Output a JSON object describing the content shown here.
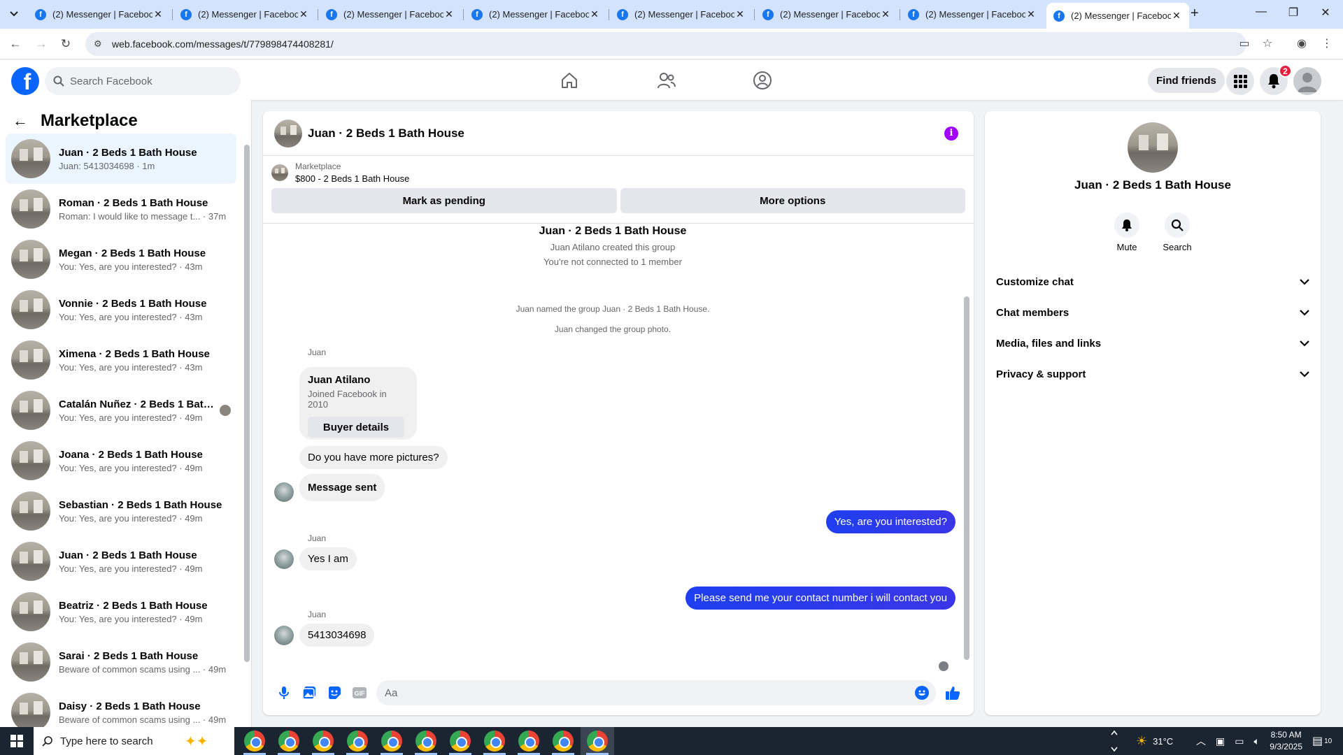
{
  "browser": {
    "tabs": [
      {
        "title": "(2) Messenger | Facebook"
      },
      {
        "title": "(2) Messenger | Facebook"
      },
      {
        "title": "(2) Messenger | Facebook"
      },
      {
        "title": "(2) Messenger | Facebook"
      },
      {
        "title": "(2) Messenger | Facebook"
      },
      {
        "title": "(2) Messenger | Facebook"
      },
      {
        "title": "(2) Messenger | Facebook"
      },
      {
        "title": "(2) Messenger | Facebook"
      }
    ],
    "url": "web.facebook.com/messages/t/779898474408281/"
  },
  "fb": {
    "search_placeholder": "Search Facebook",
    "find_friends": "Find friends",
    "notif_count": "2",
    "brand_color": "#0866ff"
  },
  "sidebar": {
    "title": "Marketplace",
    "conversations": [
      {
        "name": "Juan · 2 Beds 1 Bath House",
        "preview": "Juan: 5413034698 · 1m"
      },
      {
        "name": "Roman · 2 Beds 1 Bath House",
        "preview": "Roman: I would like to message t... · 37m"
      },
      {
        "name": "Megan · 2 Beds 1 Bath House",
        "preview": "You: Yes, are you interested? · 43m"
      },
      {
        "name": "Vonnie · 2 Beds 1 Bath House",
        "preview": "You: Yes, are you interested? · 43m"
      },
      {
        "name": "Ximena · 2 Beds 1 Bath House",
        "preview": "You: Yes, are you interested? · 43m"
      },
      {
        "name": "Catalán Nuñez · 2 Beds 1 Bath...",
        "preview": "You: Yes, are you interested? · 49m"
      },
      {
        "name": "Joana · 2 Beds 1 Bath House",
        "preview": "You: Yes, are you interested? · 49m"
      },
      {
        "name": "Sebastian · 2 Beds 1 Bath House",
        "preview": "You: Yes, are you interested? · 49m"
      },
      {
        "name": "Juan · 2 Beds 1 Bath House",
        "preview": "You: Yes, are you interested? · 49m"
      },
      {
        "name": "Beatriz · 2 Beds 1 Bath House",
        "preview": "You: Yes, are you interested? · 49m"
      },
      {
        "name": "Sarai · 2 Beds 1 Bath House",
        "preview": "Beware of common scams using ... · 49m"
      },
      {
        "name": "Daisy · 2 Beds 1 Bath House",
        "preview": "Beware of common scams using ... · 49m"
      }
    ]
  },
  "chat": {
    "title": "Juan · 2 Beds 1 Bath House",
    "marketplace_label": "Marketplace",
    "listing": "$800 - 2 Beds 1 Bath House",
    "mark_pending": "Mark as pending",
    "more_options": "More options",
    "group_title": "Juan · 2 Beds 1 Bath House",
    "created": "Juan Atilano created this group",
    "not_connected": "You're not connected to 1 member",
    "named": "Juan named the group Juan · 2 Beds 1 Bath House.",
    "changed_photo": "Juan changed the group photo.",
    "sender": "Juan",
    "card_name": "Juan Atilano",
    "card_sub": "Joined Facebook in 2010",
    "card_btn": "Buyer details",
    "m1": "Do you have more pictures?",
    "m2": "Message sent",
    "m3": "Yes, are you interested?",
    "m4": "Yes I am",
    "m5": "Please send me your contact number i will contact you",
    "m6": "5413034698",
    "composer_placeholder": "Aa",
    "outgoing_color": "#2d3be9"
  },
  "info": {
    "name": "Juan · 2 Beds 1 Bath House",
    "mute": "Mute",
    "search": "Search",
    "sections": [
      "Customize chat",
      "Chat members",
      "Media, files and links",
      "Privacy & support"
    ]
  },
  "taskbar": {
    "search_placeholder": "Type here to search",
    "temp": "31°C",
    "time": "8:50 AM",
    "date": "9/3/2025",
    "notif": "10"
  }
}
